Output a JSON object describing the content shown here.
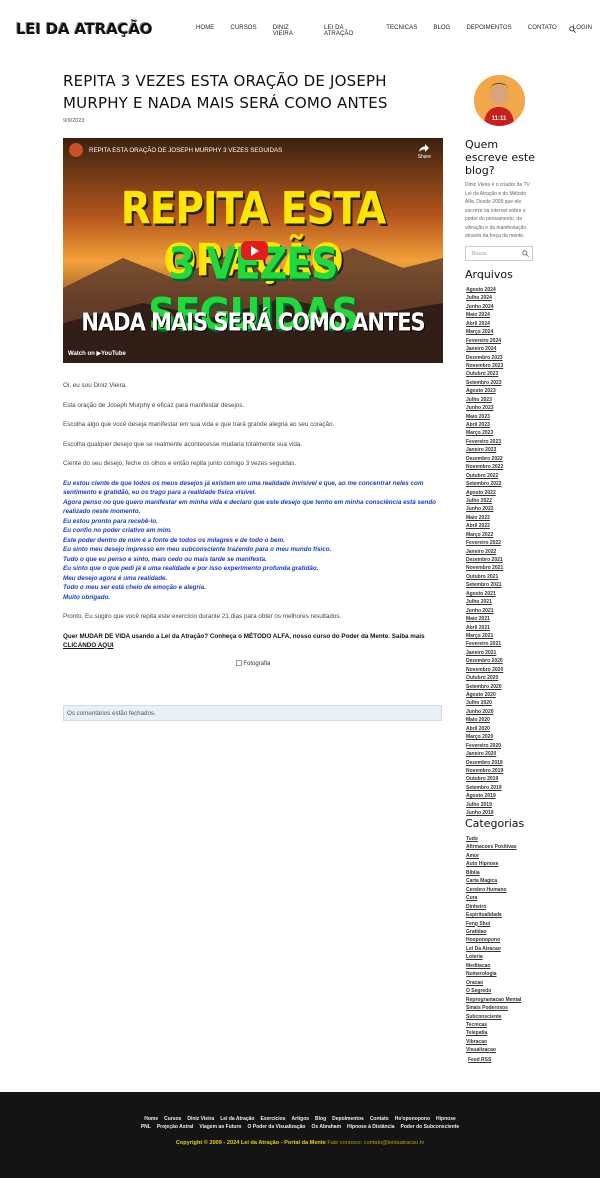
{
  "header": {
    "logo": "LEI DA ATRAÇÃO",
    "nav": [
      "Home",
      "CURSOS",
      "DINIZ VIEIRA",
      "LEI DA ATRAÇÃO",
      "TECNICAS",
      "BLOG",
      "DEPOIMENTOS",
      "CONTATO",
      "LOGIN"
    ]
  },
  "post": {
    "title": "REPITA 3 VEZES ESTA ORAÇÃO DE JOSEPH MURPHY E NADA MAIS SERÁ COMO ANTES",
    "date": "9/9/2023"
  },
  "video": {
    "title": "REPITA ESTA ORAÇÃO DE JOSEPH MURPHY 3 VEZES SEGUIDAS",
    "share": "Share",
    "line1": "REPITA ESTA ORAÇÃO",
    "line2": "3 VEZES SEGUIDAS",
    "line3": "NADA MAIS SERÁ COMO ANTES",
    "watch": "Watch on ▶YouTube"
  },
  "article": {
    "p1": "Oi, eu sou Diniz Vieira.",
    "p2": "Esta oração de Joseph Murphy é eficaz para manifestar desejos.",
    "p3": "Escolha algo que você deseja manifestar em sua vida e que trará grande alegria ao seu coração.",
    "p4": "Escolha qualquer desejo que se realmente acontecesse mudaria totalmente sua vida.",
    "p5": "Ciente do seu desejo, feche os olhos e então repita junto comigo 3 vezes seguidas.",
    "prayer": [
      "Eu estou ciente de que todos os meus desejos já existem em uma realidade invisível e que, ao me concentrar neles com sentimento e gratidão, eu os trago para a realidade física visível.",
      "Agora penso no que quero manifestar em minha vida e declaro que este desejo que tenho em minha consciência está sendo realizado neste momento.",
      "Eu estou pronto para recebê-lo.",
      "Eu confio no poder criativo em mim.",
      "Este poder dentro de mim é a fonte de todos os milagres e de todo o bem.",
      "Eu sinto meu desejo impresso em meu subconsciente trazendo para o meu mundo físico.",
      "Tudo o que eu penso e sinto, mais cedo ou mais tarde se manifesta.",
      "Eu sinto que o que pedi já é uma realidade e por isso experimento profunda gratidão.",
      "Meu desejo agora é uma realidade.",
      "Todo o meu ser está cheio de emoção e alegria.",
      "Muito obrigado."
    ],
    "p6": "Pronto. Eu sugiro que você repita este exercício durante 21 dias para obter os melhores resultados.",
    "cta": "Quer MUDAR DE VIDA usando a Lei da Atração? Conheça o MÉTODO ALFA, nosso curso do Poder da Mente. Saiba mais",
    "cta_link": "CLICANDO AQUI",
    "foto": "Fotografia"
  },
  "comments_closed": "Os comentários estão fechados.",
  "sidebar": {
    "author_heading": "Quem escreve este blog?",
    "about": "Diniz Vieira é o criador da TV Lei da Atração e do Método Alfa. Desde 2009 que ele escreve na internet sobre o poder do pensamento, da vibração e da manifestação através da força da mente.",
    "search_placeholder": "Busca",
    "archives_heading": "Arquivos",
    "archives": [
      "Agosto 2024",
      "Julho 2024",
      "Junho 2024",
      "Maio 2024",
      "Abril 2024",
      "Março 2024",
      "Fevereiro 2024",
      "Janeiro 2024",
      "Dezembro 2023",
      "Novembro 2023",
      "Outubro 2023",
      "Setembro 2023",
      "Agosto 2023",
      "Julho 2023",
      "Junho 2023",
      "Maio 2023",
      "Abril 2023",
      "Março 2023",
      "Fevereiro 2023",
      "Janeiro 2023",
      "Dezembro 2022",
      "Novembro 2022",
      "Outubro 2022",
      "Setembro 2022",
      "Agosto 2022",
      "Julho 2022",
      "Junho 2022",
      "Maio 2022",
      "Abril 2022",
      "Março 2022",
      "Fevereiro 2022",
      "Janeiro 2022",
      "Dezembro 2021",
      "Novembro 2021",
      "Outubro 2021",
      "Setembro 2021",
      "Agosto 2021",
      "Julho 2021",
      "Junho 2021",
      "Maio 2021",
      "Abril 2021",
      "Março 2021",
      "Fevereiro 2021",
      "Janeiro 2021",
      "Dezembro 2020",
      "Novembro 2020",
      "Outubro 2020",
      "Setembro 2020",
      "Agosto 2020",
      "Julho 2020",
      "Junho 2020",
      "Maio 2020",
      "Abril 2020",
      "Março 2020",
      "Fevereiro 2020",
      "Janeiro 2020",
      "Dezembro 2019",
      "Novembro 2019",
      "Outubro 2019",
      "Setembro 2019",
      "Agosto 2019",
      "Julho 2019",
      "Junho 2019"
    ],
    "categories_heading": "Categorias",
    "categories": [
      "Tudo",
      "Afirmacoes Positivas",
      "Amor",
      "Auto Hipnose",
      "Biblia",
      "Carta Magica",
      "Cerebro Humano",
      "Cura",
      "Dinheiro",
      "Espiritualidade",
      "Feng Shui",
      "Gratidao",
      "Hooponopono",
      "Lei Da Atracao",
      "Loteria",
      "Meditacao",
      "Numerologia",
      "Oracao",
      "O Segredo",
      "Reprogramacao Mental",
      "Sinais Poderosos",
      "Subconsciente",
      "Tecnicas",
      "Telepatia",
      "Vibracao",
      "Visualizacao"
    ],
    "feed": "Feed RSS"
  },
  "footer": {
    "row1": [
      "Home",
      "Cursos",
      "Diniz Vieira",
      "Lei da Atração",
      "Exercícios",
      "Artigos",
      "Blog",
      "Depoimentos",
      "Contato",
      "Ho'oponopono",
      "Hipnose"
    ],
    "row2": [
      "PNL",
      "Projeção Astral",
      "Viagem ao Futuro",
      "O Poder da Visualização",
      "Os Abraham",
      "Hipnose à Distância",
      "Poder do Subconsciente"
    ],
    "copyright": "Copyright © 2009 - 2024 Lei da Atração - Portal da Mente",
    "contact": "Fale conosco: contato@leidaatracao.tv"
  }
}
